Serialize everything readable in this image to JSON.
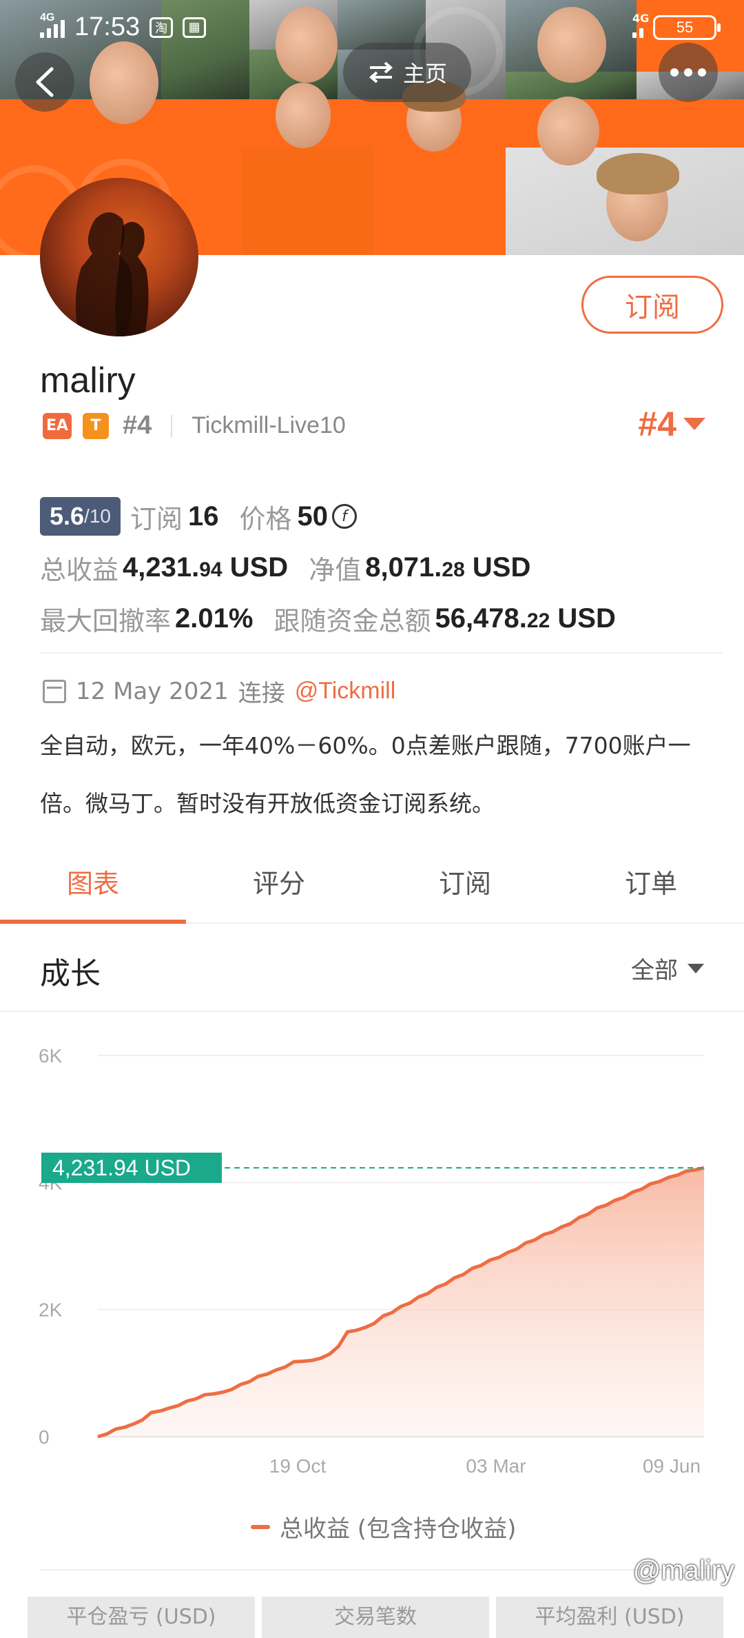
{
  "status": {
    "time": "17:53",
    "network_left": "4G",
    "network_right": "4G",
    "battery": "55"
  },
  "header": {
    "home_label": "主页"
  },
  "profile": {
    "subscribe_label": "订阅",
    "name": "maliry",
    "tag_ea": "EA",
    "tag_t": "T",
    "rank_small": "#4",
    "broker": "Tickmill-Live10",
    "rank_big": "#4"
  },
  "stats": {
    "score_main": "5.6",
    "score_max": "/10",
    "subscribe_label": "订阅",
    "subscribe_count": "16",
    "price_label": "价格",
    "price_value": "50",
    "coin_symbol": "f",
    "total_profit_label": "总收益",
    "total_profit_int": "4,231.",
    "total_profit_dec": "94",
    "total_profit_unit": "USD",
    "equity_label": "净值",
    "equity_int": "8,071.",
    "equity_dec": "28",
    "equity_unit": "USD",
    "drawdown_label": "最大回撤率",
    "drawdown_value": "2.01%",
    "follow_label": "跟随资金总额",
    "follow_int": "56,478.",
    "follow_dec": "22",
    "follow_unit": "USD"
  },
  "meta": {
    "date": "12 May 2021",
    "connect_label": "连接",
    "connect_link": "@Tickmill",
    "description": "全自动，欧元，一年40%－60%。0点差账户跟随，7700账户一倍。微马丁。暂时没有开放低资金订阅系统。"
  },
  "tabs": [
    "图表",
    "评分",
    "订阅",
    "订单"
  ],
  "section": {
    "title": "成长",
    "filter": "全部"
  },
  "chart_data": {
    "type": "area",
    "yticks": [
      "6K",
      "4K",
      "2K",
      "0"
    ],
    "ylim": [
      0,
      6000
    ],
    "xticks": [
      "19 Oct",
      "03 Mar",
      "09 Jun"
    ],
    "current_label": "4,231.94 USD",
    "current_value": 4231.94,
    "legend": "总收益 (包含持仓收益)",
    "series": [
      {
        "values": [
          0,
          120,
          200,
          380,
          450,
          560,
          660,
          700,
          820,
          950,
          1050,
          1180,
          1200,
          1300,
          1650,
          1720,
          1900,
          2050,
          2200,
          2350,
          2500,
          2650,
          2780,
          2900,
          3050,
          3180,
          3300,
          3450,
          3600,
          3720,
          3850,
          3980,
          4080,
          4180,
          4231.94
        ]
      }
    ],
    "color": "#ee6d43",
    "current_badge_color": "#1aa98b"
  },
  "footer": {
    "watermark": "@maliry",
    "bottom_tabs": [
      "平仓盈亏 (USD)",
      "交易笔数",
      "平均盈利 (USD)"
    ]
  }
}
